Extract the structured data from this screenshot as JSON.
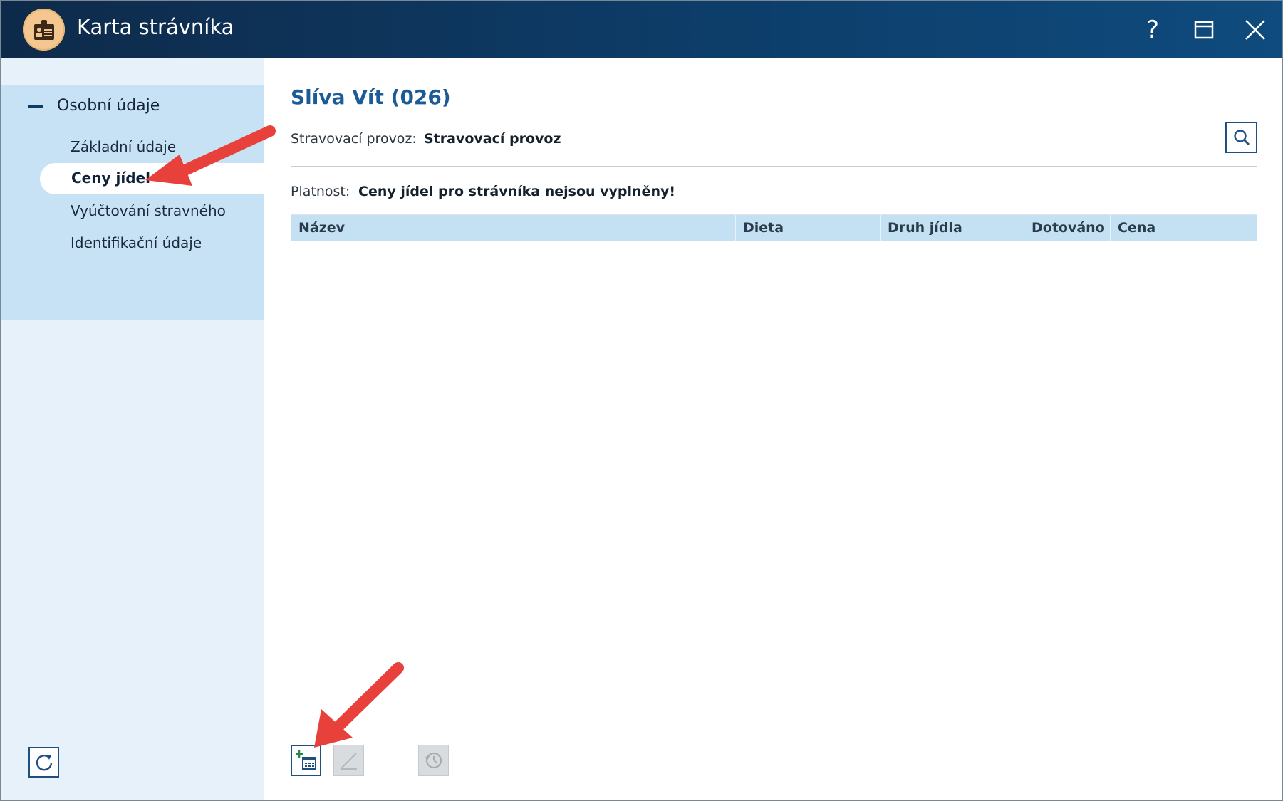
{
  "window": {
    "title": "Karta strávníka",
    "help_glyph": "?",
    "icons": [
      "person-card-icon",
      "maximize-icon",
      "close-icon"
    ]
  },
  "sidebar": {
    "group_label": "Osobní údaje",
    "items": [
      {
        "label": "Základní údaje",
        "selected": false
      },
      {
        "label": "Ceny jídel",
        "selected": true
      },
      {
        "label": "Vyúčtování stravného",
        "selected": false
      },
      {
        "label": "Identifikační údaje",
        "selected": false
      }
    ]
  },
  "main": {
    "title": "Slíva Vít (026)",
    "provoz_label": "Stravovací provoz:",
    "provoz_value": "Stravovací provoz",
    "platnost_label": "Platnost:",
    "platnost_value": "Ceny jídel pro strávníka nejsou vyplněny!",
    "table": {
      "columns": [
        "Název",
        "Dieta",
        "Druh jídla",
        "Dotováno",
        "Cena"
      ],
      "rows": []
    }
  },
  "colors": {
    "titlebar": "#0d3d69",
    "accent": "#1b5c97",
    "sidebar_group": "#c7e2f4",
    "table_header": "#c4e1f3",
    "annotation_arrow": "#e8413c"
  }
}
